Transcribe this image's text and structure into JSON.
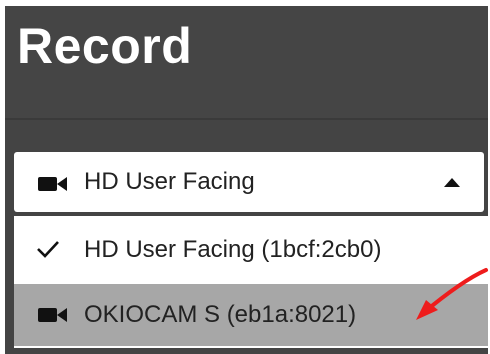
{
  "header": {
    "title": "Record"
  },
  "camera_select": {
    "selected_label": "HD User Facing",
    "icon": "video-camera-icon",
    "expanded": true
  },
  "camera_menu": {
    "options": [
      {
        "label": "HD User Facing (1bcf:2cb0)",
        "icon": "check-icon",
        "selected": true
      },
      {
        "label": "OKIOCAM S (eb1a:8021)",
        "icon": "video-camera-icon",
        "highlighted": true
      }
    ]
  },
  "annotation": {
    "arrow_color": "#ee1c1c"
  },
  "colors": {
    "header_bg": "#454545",
    "highlight_bg": "#a7a7a7",
    "text": "#222222",
    "title_text": "#ffffff"
  }
}
